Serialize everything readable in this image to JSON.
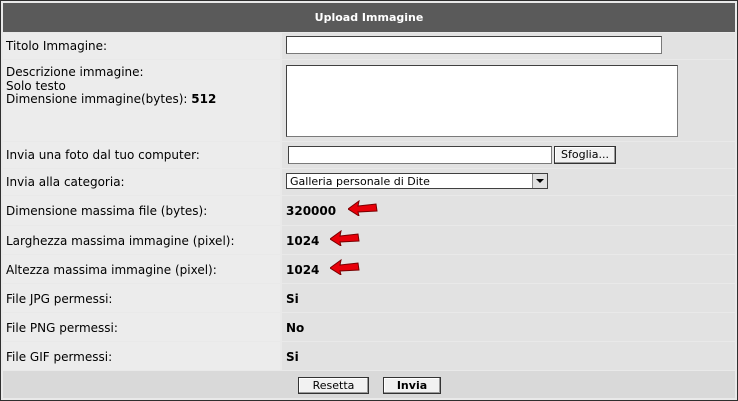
{
  "header": {
    "title": "Upload Immagine"
  },
  "form": {
    "title_label": "Titolo Immagine:",
    "title_value": "",
    "desc_label": "Descrizione immagine:",
    "desc_note": "Solo testo",
    "desc_size_label": "Dimensione immagine(bytes):",
    "desc_size_value": "512",
    "desc_value": "",
    "upload_label": "Invia una foto dal tuo computer:",
    "browse_button": "Sfoglia...",
    "category_label": "Invia alla categoria:",
    "category_value": "Galleria personale di Dite",
    "max_file_label": "Dimensione massima file (bytes):",
    "max_file_value": "320000",
    "max_width_label": "Larghezza massima immagine (pixel):",
    "max_width_value": "1024",
    "max_height_label": "Altezza massima immagine (pixel):",
    "max_height_value": "1024",
    "jpg_label": "File JPG permessi:",
    "jpg_value": "Si",
    "png_label": "File PNG permessi:",
    "png_value": "No",
    "gif_label": "File GIF permessi:",
    "gif_value": "Si"
  },
  "buttons": {
    "reset": "Resetta",
    "submit": "Invia"
  },
  "colors": {
    "header_bg": "#5a5a5a",
    "arrow": "#e8000a"
  }
}
